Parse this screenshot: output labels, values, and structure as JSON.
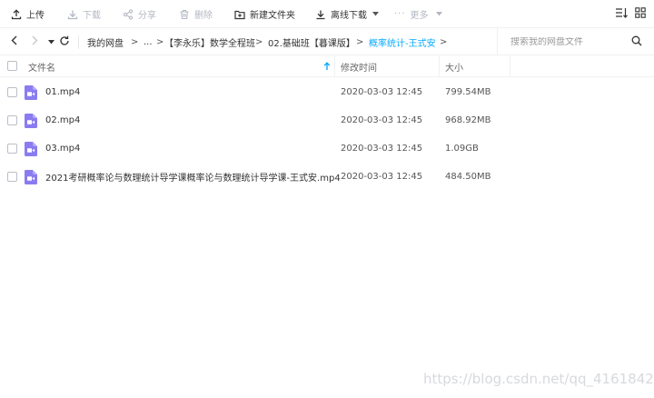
{
  "toolbar": {
    "upload": "上传",
    "download": "下载",
    "share": "分享",
    "delete": "删除",
    "new_folder": "新建文件夹",
    "offline_download": "离线下载",
    "more": "更多"
  },
  "breadcrumb": {
    "root": "我的网盘",
    "ellipsis": "...",
    "items": [
      "【李永乐】数学全程班",
      "02.基础班【暮课版】"
    ],
    "current": "概率统计-王式安",
    "separator": ">"
  },
  "search": {
    "placeholder": "搜索我的网盘文件"
  },
  "columns": {
    "name": "文件名",
    "modified": "修改时间",
    "size": "大小"
  },
  "files": [
    {
      "name": "01.mp4",
      "modified": "2020-03-03 12:45",
      "size": "799.54MB"
    },
    {
      "name": "02.mp4",
      "modified": "2020-03-03 12:45",
      "size": "968.92MB"
    },
    {
      "name": "03.mp4",
      "modified": "2020-03-03 12:45",
      "size": "1.09GB"
    },
    {
      "name": "2021考研概率论与数理统计导学课概率论与数理统计导学课-王式安.mp4",
      "modified": "2020-03-03 12:45",
      "size": "484.50MB"
    }
  ],
  "watermark": "https://blog.csdn.net/qq_41618424",
  "colors": {
    "accent": "#09aaff",
    "video_icon": "#8a7cf0",
    "disabled": "#b3b8c2"
  }
}
